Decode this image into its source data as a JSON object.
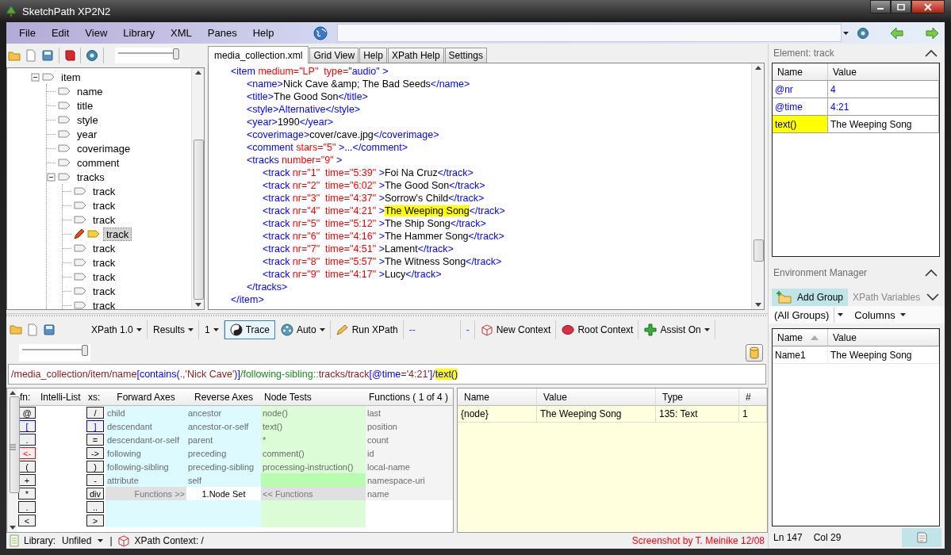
{
  "window": {
    "title": "SketchPath XP2N2"
  },
  "menu": [
    "File",
    "Edit",
    "View",
    "Library",
    "XML",
    "Panes",
    "Help"
  ],
  "tree_toolbar": {
    "zoom_slider": {
      "level": 0.97
    }
  },
  "tree": [
    {
      "label": "item",
      "expanded": true,
      "selected": false,
      "children": [
        {
          "label": "name",
          "selected": false
        },
        {
          "label": "title",
          "selected": false
        },
        {
          "label": "style",
          "selected": false
        },
        {
          "label": "year",
          "selected": false
        },
        {
          "label": "coverimage",
          "selected": false
        },
        {
          "label": "comment",
          "selected": false
        },
        {
          "label": "tracks",
          "expanded": true,
          "selected": false,
          "children": [
            {
              "label": "track",
              "selected": false
            },
            {
              "label": "track",
              "selected": false
            },
            {
              "label": "track",
              "selected": false
            },
            {
              "label": "track",
              "selected": true
            },
            {
              "label": "track",
              "selected": false
            },
            {
              "label": "track",
              "selected": false
            },
            {
              "label": "track",
              "selected": false
            },
            {
              "label": "track",
              "selected": false
            },
            {
              "label": "track",
              "selected": false
            }
          ]
        }
      ]
    }
  ],
  "editor": {
    "tabs": [
      {
        "label": "media_collection.xml",
        "selected": true
      },
      {
        "label": "Grid View",
        "selected": false
      },
      {
        "label": "Help",
        "selected": false
      },
      {
        "label": "XPath Help",
        "selected": false
      },
      {
        "label": "Settings",
        "selected": false
      }
    ],
    "lines": [
      {
        "tokens": [
          {
            "kind": "tag",
            "text": "<item"
          },
          {
            "kind": "attr",
            "text": " medium=\"LP\""
          },
          {
            "kind": "attr",
            "text": "  type="
          },
          {
            "kind": "value",
            "text": "\"audio\""
          },
          {
            "kind": "tag",
            "text": " >"
          }
        ],
        "children": [
          {
            "tokens": [
              {
                "kind": "tag",
                "text": "<name>"
              },
              {
                "kind": "text",
                "text": "Nick Cave &amp; The Bad Seeds"
              },
              {
                "kind": "tag",
                "text": "</name>"
              }
            ]
          },
          {
            "tokens": [
              {
                "kind": "tag",
                "text": "<title>"
              },
              {
                "kind": "text",
                "text": "The Good Son"
              },
              {
                "kind": "tag",
                "text": "</title>"
              }
            ]
          },
          {
            "tokens": [
              {
                "kind": "tag",
                "text": "<style>"
              },
              {
                "kind": "value",
                "text": "Alternative"
              },
              {
                "kind": "tag",
                "text": "</style>"
              }
            ]
          },
          {
            "tokens": [
              {
                "kind": "tag",
                "text": "<year>"
              },
              {
                "kind": "text",
                "text": "1990"
              },
              {
                "kind": "tag",
                "text": "</year>"
              }
            ]
          },
          {
            "tokens": [
              {
                "kind": "tag",
                "text": "<coverimage>"
              },
              {
                "kind": "text",
                "text": "cover/cave.jpg"
              },
              {
                "kind": "tag",
                "text": "</coverimage>"
              }
            ]
          },
          {
            "tokens": [
              {
                "kind": "tag",
                "text": "<comment"
              },
              {
                "kind": "attr",
                "text": " stars=\"5\""
              },
              {
                "kind": "tag",
                "text": " >...</comment>"
              }
            ]
          },
          {
            "tokens": [
              {
                "kind": "tag",
                "text": "<tracks"
              },
              {
                "kind": "attr",
                "text": " number=\"9\""
              },
              {
                "kind": "tag",
                "text": " >"
              }
            ],
            "children": [
              {
                "tokens": [
                  {
                    "kind": "tag",
                    "text": "<track"
                  },
                  {
                    "kind": "attr",
                    "text": " nr=\"1\"  time=\"5:39\""
                  },
                  {
                    "kind": "tag",
                    "text": " >"
                  },
                  {
                    "kind": "text",
                    "text": "Foi Na Cruz"
                  },
                  {
                    "kind": "tag",
                    "text": "</track>"
                  }
                ]
              },
              {
                "tokens": [
                  {
                    "kind": "tag",
                    "text": "<track"
                  },
                  {
                    "kind": "attr",
                    "text": " nr=\"2\"  time=\"6:02\""
                  },
                  {
                    "kind": "tag",
                    "text": " >"
                  },
                  {
                    "kind": "text",
                    "text": "The Good Son"
                  },
                  {
                    "kind": "tag",
                    "text": "</track>"
                  }
                ]
              },
              {
                "tokens": [
                  {
                    "kind": "tag",
                    "text": "<track"
                  },
                  {
                    "kind": "attr",
                    "text": " nr=\"3\"  time=\"4:37\""
                  },
                  {
                    "kind": "tag",
                    "text": " >"
                  },
                  {
                    "kind": "text",
                    "text": "Sorrow's Child"
                  },
                  {
                    "kind": "tag",
                    "text": "</track>"
                  }
                ]
              },
              {
                "tokens": [
                  {
                    "kind": "tag",
                    "text": "<track"
                  },
                  {
                    "kind": "attr",
                    "text": " nr=\"4\"  time=\"4:21\""
                  },
                  {
                    "kind": "tag",
                    "text": " >"
                  },
                  {
                    "kind": "highlight",
                    "text": "The Weeping Song"
                  },
                  {
                    "kind": "tag",
                    "text": "</track>"
                  }
                ]
              },
              {
                "tokens": [
                  {
                    "kind": "tag",
                    "text": "<track"
                  },
                  {
                    "kind": "attr",
                    "text": " nr=\"5\"  time=\"5:12\""
                  },
                  {
                    "kind": "tag",
                    "text": " >"
                  },
                  {
                    "kind": "text",
                    "text": "The Ship Song"
                  },
                  {
                    "kind": "tag",
                    "text": "</track>"
                  }
                ]
              },
              {
                "tokens": [
                  {
                    "kind": "tag",
                    "text": "<track"
                  },
                  {
                    "kind": "attr",
                    "text": " nr=\"6\"  time=\"4:16\""
                  },
                  {
                    "kind": "tag",
                    "text": " >"
                  },
                  {
                    "kind": "text",
                    "text": "The Hammer Song"
                  },
                  {
                    "kind": "tag",
                    "text": "</track>"
                  }
                ]
              },
              {
                "tokens": [
                  {
                    "kind": "tag",
                    "text": "<track"
                  },
                  {
                    "kind": "attr",
                    "text": " nr=\"7\"  time=\"4:51\""
                  },
                  {
                    "kind": "tag",
                    "text": " >"
                  },
                  {
                    "kind": "text",
                    "text": "Lament"
                  },
                  {
                    "kind": "tag",
                    "text": "</track>"
                  }
                ]
              },
              {
                "tokens": [
                  {
                    "kind": "tag",
                    "text": "<track"
                  },
                  {
                    "kind": "attr",
                    "text": " nr=\"8\"  time=\"5:57\""
                  },
                  {
                    "kind": "tag",
                    "text": " >"
                  },
                  {
                    "kind": "text",
                    "text": "The Witness Song"
                  },
                  {
                    "kind": "tag",
                    "text": "</track>"
                  }
                ]
              },
              {
                "tokens": [
                  {
                    "kind": "tag",
                    "text": "<track"
                  },
                  {
                    "kind": "attr",
                    "text": " nr=\"9\"  time=\"4:17\""
                  },
                  {
                    "kind": "tag",
                    "text": " >"
                  },
                  {
                    "kind": "text",
                    "text": "Lucy"
                  },
                  {
                    "kind": "tag",
                    "text": "</track>"
                  }
                ]
              }
            ]
          },
          {
            "tokens": [
              {
                "kind": "tag",
                "text": "</tracks>"
              }
            ]
          }
        ]
      },
      {
        "tokens": [
          {
            "kind": "tag",
            "text": "</item>"
          }
        ]
      }
    ]
  },
  "xpath_toolbar": {
    "items": [
      {
        "kind": "dropdown",
        "label": "XPath 1.0"
      },
      {
        "kind": "dropdown",
        "label": "Results"
      },
      {
        "kind": "dropdown",
        "label": "1"
      },
      {
        "kind": "toggle",
        "label": "Trace",
        "on": true
      },
      {
        "kind": "icon_dropdown",
        "label": "Auto"
      },
      {
        "kind": "button",
        "label": "Run XPath"
      },
      {
        "kind": "label",
        "label": "--"
      },
      {
        "kind": "label",
        "label": "-"
      },
      {
        "kind": "button",
        "label": "New Context"
      },
      {
        "kind": "button",
        "label": "Root Context"
      },
      {
        "kind": "icon_dropdown",
        "label": "Assist On"
      }
    ]
  },
  "xpath_slider": {
    "level": 0.95
  },
  "expression": {
    "tokens": [
      {
        "kind": "path",
        "text": "/media_collection/item/name"
      },
      {
        "kind": "op",
        "text": "[contains("
      },
      {
        "kind": "path",
        "text": ".,"
      },
      {
        "kind": "literal",
        "text": "'Nick Cave'"
      },
      {
        "kind": "op",
        "text": ")]"
      },
      {
        "kind": "axis",
        "text": "/following-sibling::"
      },
      {
        "kind": "path",
        "text": "tracks/track"
      },
      {
        "kind": "op",
        "text": "[@time"
      },
      {
        "kind": "path",
        "text": "="
      },
      {
        "kind": "literal",
        "text": "'4:21'"
      },
      {
        "kind": "op",
        "text": "]"
      },
      {
        "kind": "path",
        "text": "/"
      },
      {
        "kind": "highlight",
        "text": "text()"
      }
    ]
  },
  "intelli": {
    "columns": [
      "fn:",
      "Intelli-List",
      "xs:",
      "Forward Axes",
      "Reverse Axes",
      "Node Tests",
      "Functions ( 1 of 4 )"
    ],
    "rows": [
      {
        "kind": "item",
        "fn": {
          "symbol": "@"
        },
        "xs": {
          "symbol": "/"
        },
        "forward": "child",
        "reverse": "ancestor",
        "node_test": "node()",
        "node_test_selected": false,
        "function": "last"
      },
      {
        "kind": "item",
        "fn": {
          "symbol": "[",
          "color": "#0000ff"
        },
        "xs": {
          "symbol": "]",
          "color": "#0000ff"
        },
        "forward": "descendant",
        "reverse": "ancestor-or-self",
        "node_test": "text()",
        "node_test_selected": false,
        "function": "position"
      },
      {
        "kind": "item",
        "fn": {
          "symbol": "."
        },
        "xs": {
          "symbol": "="
        },
        "forward": "descendant-or-self",
        "reverse": "parent",
        "node_test": "*",
        "node_test_selected": false,
        "function": "count"
      },
      {
        "kind": "item",
        "fn": {
          "symbol": "<-",
          "color": "#ff0000"
        },
        "xs": {
          "symbol": "->"
        },
        "forward": "following",
        "reverse": "preceding",
        "node_test": "comment()",
        "node_test_selected": false,
        "function": "id"
      },
      {
        "kind": "item",
        "fn": {
          "symbol": "("
        },
        "xs": {
          "symbol": ")"
        },
        "forward": "following-sibling",
        "reverse": "preceding-sibling",
        "node_test": "processing-instruction()",
        "node_test_selected": false,
        "function": "local-name"
      },
      {
        "kind": "item",
        "fn": {
          "symbol": "+"
        },
        "xs": {
          "symbol": "-"
        },
        "forward": "attribute",
        "reverse": "self",
        "node_test_selected": true,
        "function": "namespace-uri"
      },
      {
        "kind": "nav",
        "fn": {
          "symbol": "*"
        },
        "xs": {
          "symbol": "div"
        },
        "forward": "Functions >>",
        "reverse": "1.Node Set",
        "node_test": "<< Functions",
        "function": "name"
      },
      {
        "kind": "empty",
        "fn": {
          "symbol": "."
        },
        "xs": {
          "symbol": ".."
        }
      },
      {
        "kind": "empty",
        "fn": {
          "symbol": "<"
        },
        "xs": {
          "symbol": ">"
        }
      }
    ]
  },
  "results": {
    "columns": [
      "Name",
      "Value",
      "Type",
      "#"
    ],
    "rows": [
      [
        "{node}",
        "The Weeping Song",
        "135: Text",
        "1"
      ]
    ]
  },
  "status_bar": {
    "library_label": "Library:",
    "library": "Unfiled",
    "separator": "|",
    "context": "XPath Context: /",
    "credit": "Screenshot by T. Meinike 12/08"
  },
  "element_panel": {
    "title": "Element: track",
    "columns": [
      "Name",
      "Value"
    ],
    "rows": [
      {
        "kind": "attribute",
        "name": "@nr",
        "value": "4"
      },
      {
        "kind": "attribute",
        "name": "@time",
        "value": "4:21"
      },
      {
        "kind": "text",
        "name": "text()",
        "value": "The Weeping Song"
      }
    ]
  },
  "environment": {
    "title": "Environment Manager",
    "tabs": [
      {
        "label": "Add Group",
        "selected": true
      },
      {
        "label": "XPath Variables",
        "selected": false
      }
    ],
    "group_filter": "(All Groups)",
    "columns_menu": "Columns",
    "columns": [
      {
        "label": "Name",
        "sorted": true
      },
      {
        "label": "Value",
        "sorted": false
      }
    ],
    "rows": [
      [
        "Name1",
        "The Weeping Song"
      ]
    ]
  },
  "position": {
    "line": "Ln 147",
    "column": "Col 29"
  }
}
